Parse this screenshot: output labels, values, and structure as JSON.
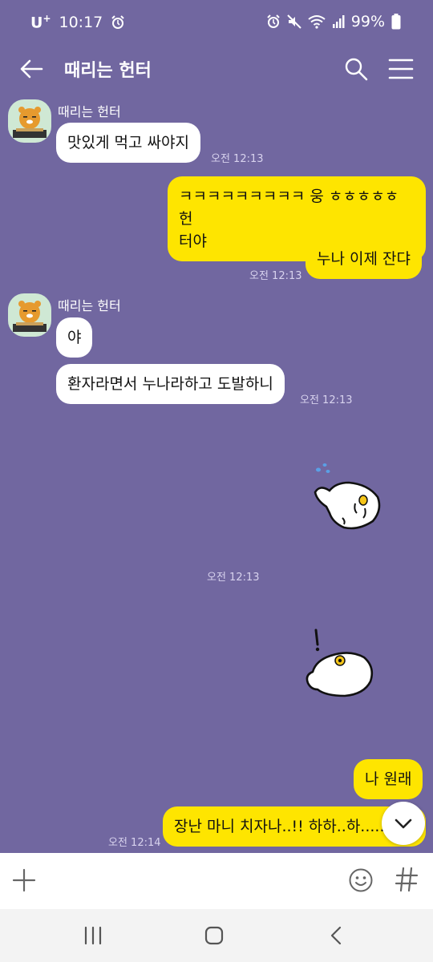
{
  "status_bar": {
    "carrier": "U",
    "carrier_sup": "+",
    "time": "10:17",
    "battery": "99%"
  },
  "header": {
    "title": "때리는 헌터"
  },
  "messages": [
    {
      "sender": "때리는 헌터",
      "text": "맛있게 먹고 싸야지",
      "time": "오전 12:13"
    },
    {
      "text_line1": "ㅋㅋㅋㅋㅋㅋㅋㅋㅋ 웅 ㅎㅎㅎㅎㅎ 헌",
      "text_line2": "터야"
    },
    {
      "text": "누나 이제 잔댜",
      "time": "오전 12:13"
    },
    {
      "sender": "때리는 헌터",
      "text": "야"
    },
    {
      "text": "환자라면서 누나라하고 도발하니",
      "time": "오전 12:13"
    },
    {
      "time": "오전 12:13"
    },
    {
      "text": "나 원래"
    },
    {
      "text": "장난 마니 치자나..!! 하하..하.....",
      "time": "오전 12:14"
    }
  ],
  "colors": {
    "background": "#7167a0",
    "outgoing_bubble": "#fee500",
    "incoming_bubble": "#ffffff"
  },
  "icons": {
    "back": "arrow-left-icon",
    "search": "search-icon",
    "menu": "hamburger-icon",
    "plus": "plus-icon",
    "emoji": "emoji-icon",
    "hash": "hash-icon",
    "scroll_down": "chevron-down-icon"
  }
}
